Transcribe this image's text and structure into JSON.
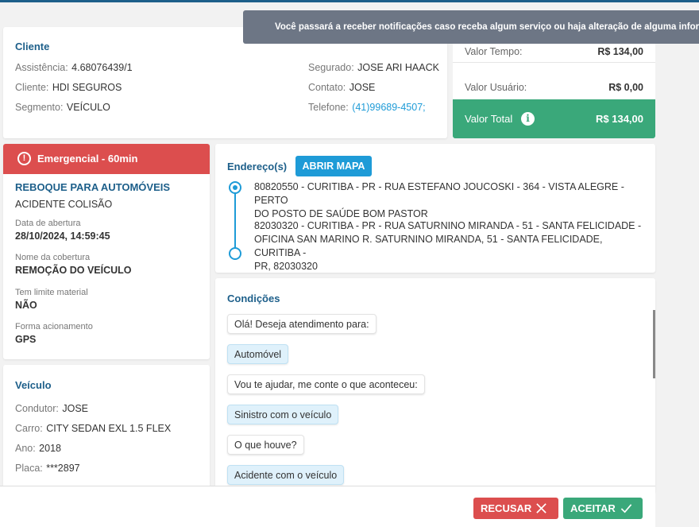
{
  "notification": {
    "text": "Você passará a receber notificações caso receba algum serviço ou haja alteração de alguma informação"
  },
  "cliente": {
    "title": "Cliente",
    "assistencia_label": "Assistência:",
    "assistencia_value": "4.68076439/1",
    "cliente_label": "Cliente:",
    "cliente_value": "HDI SEGUROS",
    "segmento_label": "Segmento:",
    "segmento_value": "VEÍCULO",
    "segurado_label": "Segurado:",
    "segurado_value": "JOSE ARI HAACK",
    "contato_label": "Contato:",
    "contato_value": "JOSE",
    "telefone_label": "Telefone:",
    "telefone_value": "(41)99689-4507;"
  },
  "valores": {
    "tempo_label": "Valor Tempo:",
    "tempo_value": "R$ 134,00",
    "usuario_label": "Valor Usuário:",
    "usuario_value": "R$ 0,00",
    "total_label": "Valor Total",
    "total_value": "R$ 134,00"
  },
  "servico": {
    "badge": "Emergencial - 60min",
    "title": "REBOQUE PARA AUTOMÓVEIS",
    "subtitle": "ACIDENTE COLISÃO",
    "abertura_label": "Data de abertura",
    "abertura_value": "28/10/2024, 14:59:45",
    "cobertura_label": "Nome da cobertura",
    "cobertura_value": "REMOÇÃO DO VEÍCULO",
    "limite_label": "Tem limite material",
    "limite_value": "NÃO",
    "forma_label": "Forma acionamento",
    "forma_value": "GPS"
  },
  "veiculo": {
    "title": "Veículo",
    "condutor_label": "Condutor:",
    "condutor_value": "JOSE",
    "carro_label": "Carro:",
    "carro_value": "CITY SEDAN EXL 1.5 FLEX",
    "ano_label": "Ano:",
    "ano_value": "2018",
    "placa_label": "Placa:",
    "placa_value": "***2897"
  },
  "enderecos": {
    "title": "Endereço(s)",
    "map_button": "ABRIR MAPA",
    "origin_line1": "80820550 - CURITIBA - PR - RUA ESTEFANO JOUCOSKI - 364 - VISTA ALEGRE - PERTO",
    "origin_line2": "DO POSTO DE SAÚDE BOM PASTOR",
    "dest_line1": "82030320 - CURITIBA - PR - RUA SATURNINO MIRANDA - 51 - SANTA FELICIDADE -",
    "dest_line2": "OFICINA SAN MARINO R. SATURNINO MIRANDA, 51 - SANTA FELICIDADE, CURITIBA -",
    "dest_line3": "PR, 82030320"
  },
  "condicoes": {
    "title": "Condições",
    "messages": [
      {
        "text": "Olá! Deseja atendimento para:"
      },
      {
        "text": "Automóvel"
      },
      {
        "text": "Vou te ajudar, me conte o que aconteceu:"
      },
      {
        "text": "Sinistro com o veículo"
      },
      {
        "text": "O que houve?"
      },
      {
        "text": "Acidente com o veículo"
      }
    ]
  },
  "actions": {
    "recusar": "RECUSAR",
    "aceitar": "ACEITAR"
  },
  "colors": {
    "primary": "#1d5f8a",
    "accent": "#1e9bd7",
    "success": "#3aa87a",
    "danger": "#dc4e4e"
  }
}
